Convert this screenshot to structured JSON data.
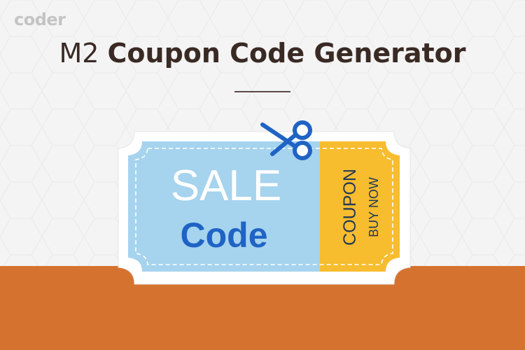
{
  "brand": {
    "logo": "coder"
  },
  "header": {
    "prefix": "M2",
    "title": "Coupon Code Generator"
  },
  "ticket": {
    "line1": "SALE",
    "line2": "Code",
    "stub_line1": "COUPON",
    "stub_line2": "BUY NOW"
  },
  "colors": {
    "background_top": "#f4f4f4",
    "background_bottom": "#d6722f",
    "ticket_main": "#a6d3ee",
    "ticket_stub": "#f7bd2f",
    "sale_text": "#ffffff",
    "code_text": "#1f63c4",
    "stub_text": "#243a52",
    "scissors": "#1f63c4"
  },
  "icons": {
    "scissors": "scissors-icon"
  }
}
